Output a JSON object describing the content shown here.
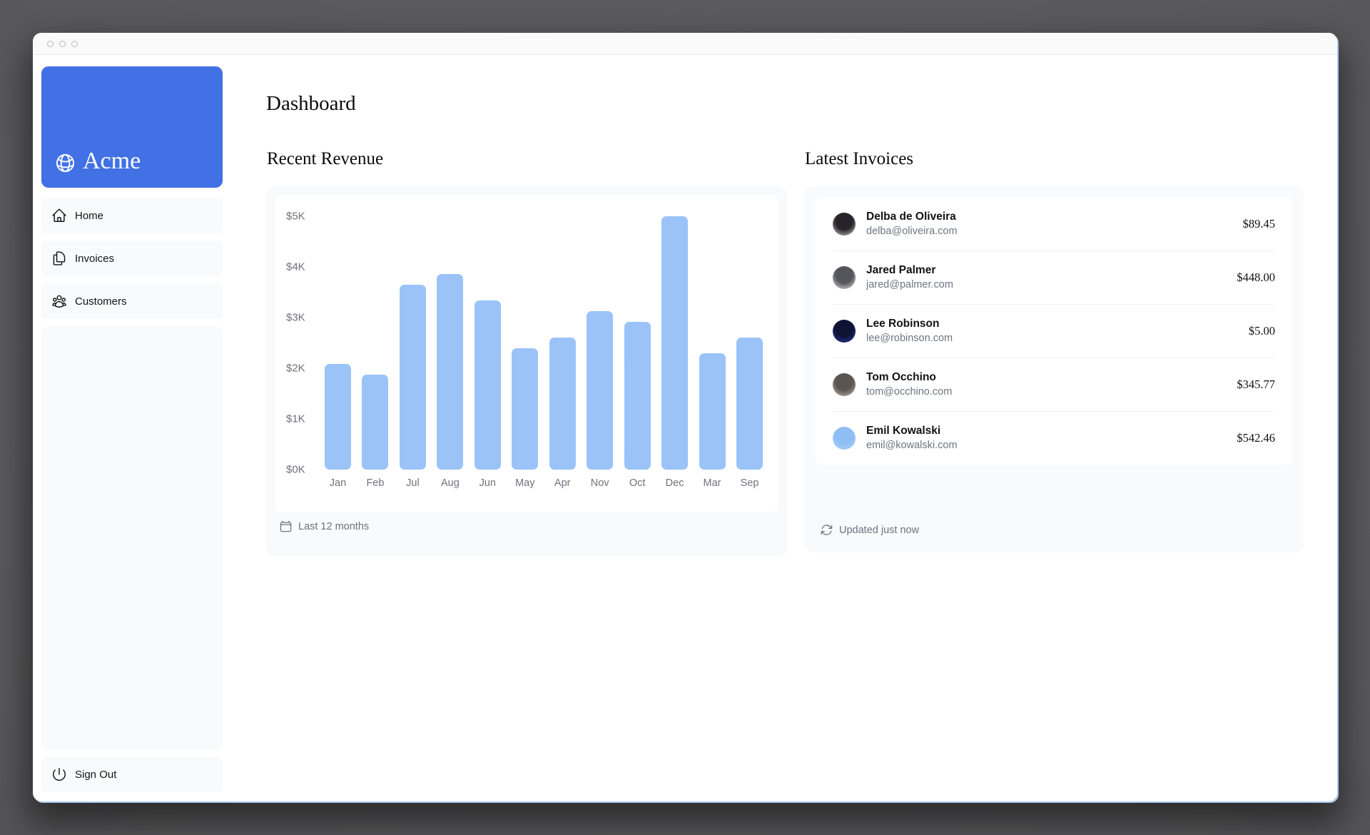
{
  "sidebar": {
    "brand": "Acme",
    "items": [
      {
        "label": "Home"
      },
      {
        "label": "Invoices"
      },
      {
        "label": "Customers"
      }
    ],
    "sign_out_label": "Sign Out"
  },
  "page": {
    "title": "Dashboard"
  },
  "revenue_panel": {
    "heading": "Recent Revenue",
    "footer": "Last 12 months"
  },
  "invoices_panel": {
    "heading": "Latest Invoices",
    "footer": "Updated just now",
    "rows": [
      {
        "name": "Delba de Oliveira",
        "email": "delba@oliveira.com",
        "amount": "$89.45",
        "avatar_colors": [
          "#d9d2ca",
          "#26242a"
        ]
      },
      {
        "name": "Jared Palmer",
        "email": "jared@palmer.com",
        "amount": "$448.00",
        "avatar_colors": [
          "#ececec",
          "#55555c"
        ]
      },
      {
        "name": "Lee Robinson",
        "email": "lee@robinson.com",
        "amount": "$5.00",
        "avatar_colors": [
          "#2b3da8",
          "#0e1233"
        ]
      },
      {
        "name": "Tom Occhino",
        "email": "tom@occhino.com",
        "amount": "$345.77",
        "avatar_colors": [
          "#c4bfb8",
          "#5b5451"
        ]
      },
      {
        "name": "Emil Kowalski",
        "email": "emil@kowalski.com",
        "amount": "$542.46",
        "avatar_colors": [
          "#b4d4f9",
          "#8fbef5"
        ]
      }
    ]
  },
  "chart_data": {
    "type": "bar",
    "title": "Recent Revenue",
    "categories": [
      "Jan",
      "Feb",
      "Jul",
      "Aug",
      "Jun",
      "May",
      "Apr",
      "Nov",
      "Oct",
      "Dec",
      "Mar",
      "Sep"
    ],
    "values": [
      2000,
      1800,
      3500,
      3700,
      3200,
      2300,
      2500,
      3000,
      2800,
      4800,
      2200,
      2500
    ],
    "xlabel": "",
    "ylabel": "",
    "y_axis_labels": [
      "$5K",
      "$4K",
      "$3K",
      "$2K",
      "$1K",
      "$0K"
    ],
    "ylim": [
      0,
      4800
    ],
    "grid": false,
    "legend": false,
    "bar_color": "#9cc3f8"
  },
  "colors": {
    "accent_blue": "#4171e4",
    "bar_blue": "#9cc3f8",
    "card_gray": "#f9fafb",
    "muted_text": "#6b7280"
  }
}
